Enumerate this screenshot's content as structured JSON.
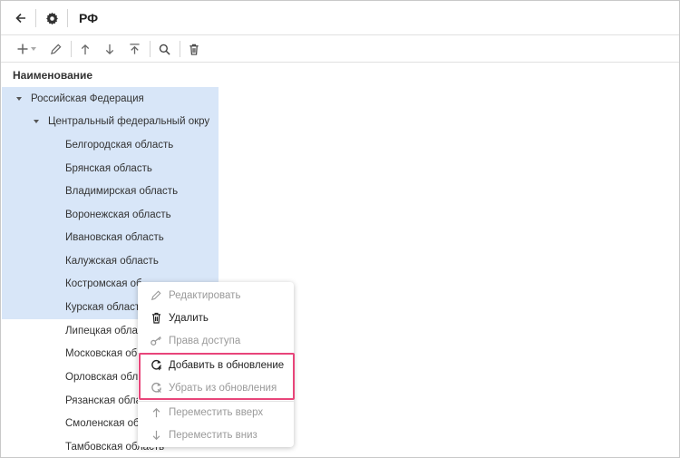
{
  "header": {
    "title": "РФ"
  },
  "table": {
    "column_name": "Наименование"
  },
  "tree": [
    {
      "label": "Российская Федерация",
      "level": 0,
      "expanded": true,
      "selected": true
    },
    {
      "label": "Центральный федеральный окру",
      "level": 1,
      "expanded": true,
      "selected": true
    },
    {
      "label": "Белгородская область",
      "level": 2,
      "selected": true
    },
    {
      "label": "Брянская область",
      "level": 2,
      "selected": true
    },
    {
      "label": "Владимирская область",
      "level": 2,
      "selected": true
    },
    {
      "label": "Воронежская область",
      "level": 2,
      "selected": true
    },
    {
      "label": "Ивановская область",
      "level": 2,
      "selected": true
    },
    {
      "label": "Калужская область",
      "level": 2,
      "selected": true
    },
    {
      "label": "Костромская об",
      "level": 2,
      "selected": true
    },
    {
      "label": "Курская област",
      "level": 2,
      "selected": true
    },
    {
      "label": "Липецкая облас",
      "level": 2,
      "selected": false
    },
    {
      "label": "Московская об",
      "level": 2,
      "selected": false
    },
    {
      "label": "Орловская обла",
      "level": 2,
      "selected": false
    },
    {
      "label": "Рязанская обла",
      "level": 2,
      "selected": false
    },
    {
      "label": "Смоленская обл",
      "level": 2,
      "selected": false
    },
    {
      "label": "Тамбовская область",
      "level": 2,
      "selected": false
    }
  ],
  "context_menu": {
    "items": [
      {
        "label": "Редактировать",
        "icon": "pencil-icon",
        "enabled": false
      },
      {
        "label": "Удалить",
        "icon": "trash-icon",
        "enabled": true
      },
      {
        "label": "Права доступа",
        "icon": "key-icon",
        "enabled": false
      },
      {
        "label": "Добавить в обновление",
        "icon": "refresh-add-icon",
        "enabled": true
      },
      {
        "label": "Убрать из обновления",
        "icon": "refresh-remove-icon",
        "enabled": false
      },
      {
        "label": "Переместить вверх",
        "icon": "arrow-up-icon",
        "enabled": false
      },
      {
        "label": "Переместить вниз",
        "icon": "arrow-down-icon",
        "enabled": false
      }
    ]
  },
  "colors": {
    "selection": "#d8e6f8",
    "highlight_border": "#e8457a"
  }
}
